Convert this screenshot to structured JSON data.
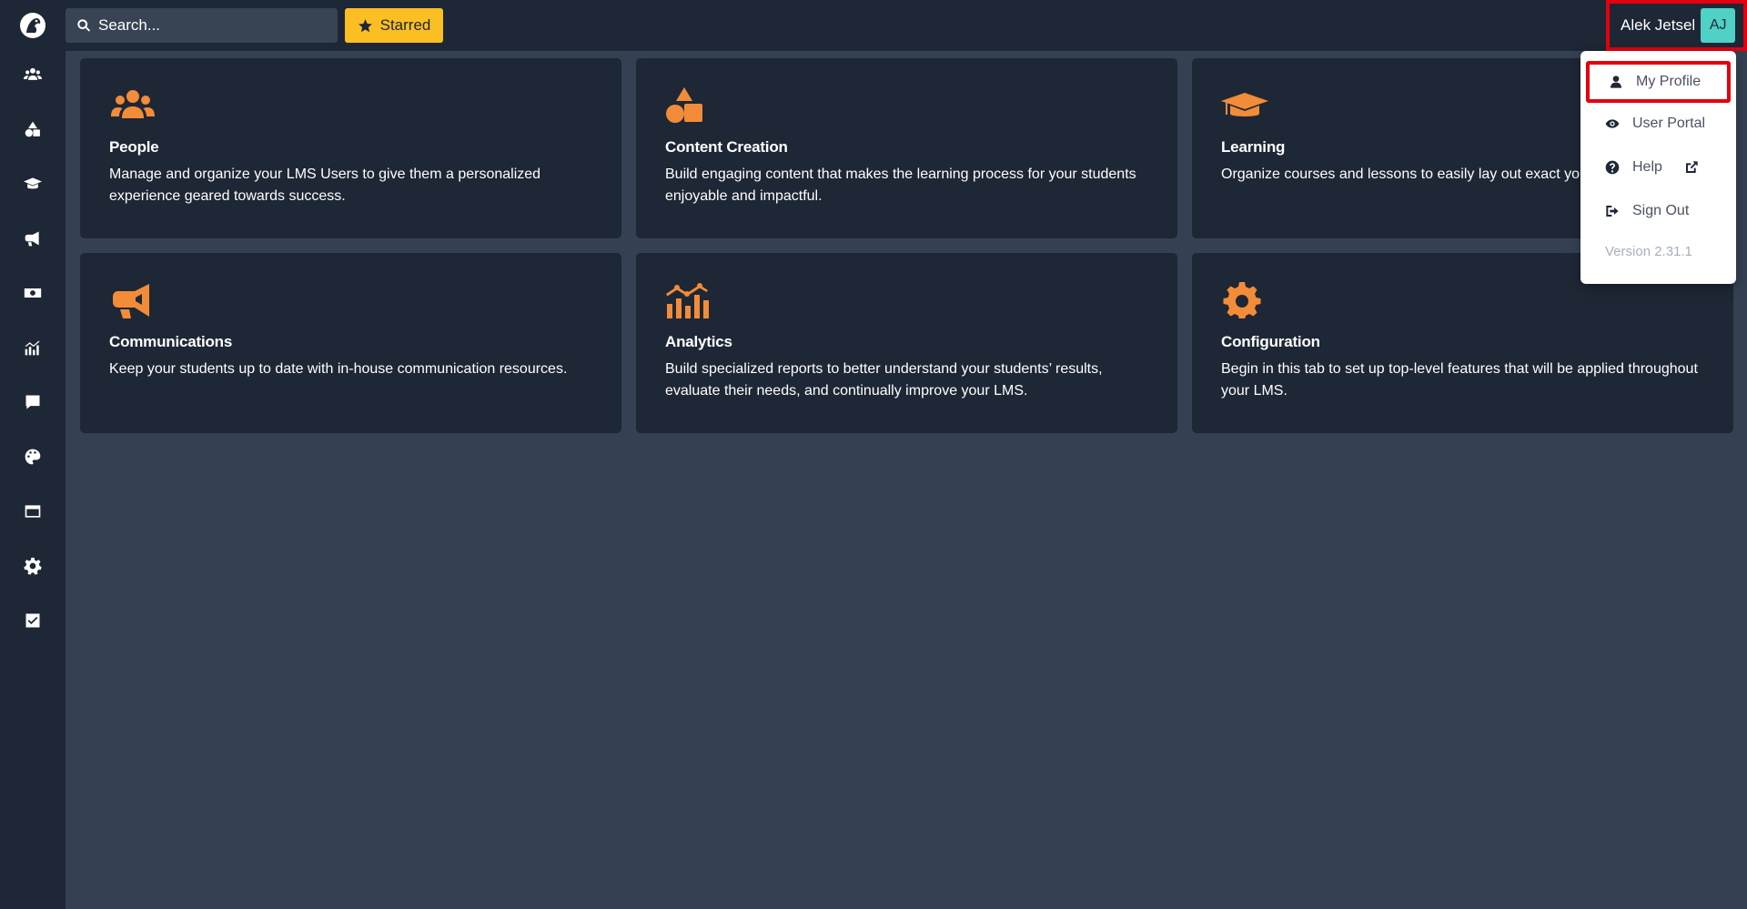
{
  "search": {
    "placeholder": "Search..."
  },
  "starred": {
    "label": "Starred"
  },
  "user": {
    "name": "Alek Jetsel",
    "initials": "AJ"
  },
  "sidebar": {
    "items": [
      {
        "icon": "people-icon"
      },
      {
        "icon": "shapes-icon"
      },
      {
        "icon": "graduation-cap-icon"
      },
      {
        "icon": "megaphone-icon"
      },
      {
        "icon": "money-bill-icon"
      },
      {
        "icon": "analytics-icon"
      },
      {
        "icon": "comment-icon"
      },
      {
        "icon": "palette-icon"
      },
      {
        "icon": "window-icon"
      },
      {
        "icon": "gear-icon"
      },
      {
        "icon": "checkbox-icon"
      }
    ]
  },
  "cards": [
    {
      "icon": "people-icon",
      "title": "People",
      "description": "Manage and organize your LMS Users to give them a personalized experience geared towards success."
    },
    {
      "icon": "shapes-icon",
      "title": "Content Creation",
      "description": "Build engaging content that makes the learning process for your students enjoyable and impactful."
    },
    {
      "icon": "graduation-cap-icon",
      "title": "Learning",
      "description": "Organize courses and lessons to easily lay out exact your students to learn."
    },
    {
      "icon": "megaphone-icon",
      "title": "Communications",
      "description": "Keep your students up to date with in-house communication resources."
    },
    {
      "icon": "analytics-icon",
      "title": "Analytics",
      "description": "Build specialized reports to better understand your students’ results, evaluate their needs, and continually improve your LMS."
    },
    {
      "icon": "gear-icon",
      "title": "Configuration",
      "description": "Begin in this tab to set up top-level features that will be applied throughout your LMS."
    }
  ],
  "dropdown": {
    "items": [
      {
        "label": "My Profile",
        "icon": "user-icon"
      },
      {
        "label": "User Portal",
        "icon": "eye-icon"
      },
      {
        "label": "Help",
        "icon": "question-circle-icon"
      },
      {
        "label": "Sign Out",
        "icon": "sign-out-icon"
      }
    ],
    "version": "Version 2.31.1"
  },
  "colors": {
    "accent": "#f28c38",
    "starred_bg": "#fbbf24",
    "avatar_bg": "#4fd1c5",
    "highlight_border": "#e3000f",
    "panel_bg": "#1e2735",
    "page_bg": "#354152"
  }
}
